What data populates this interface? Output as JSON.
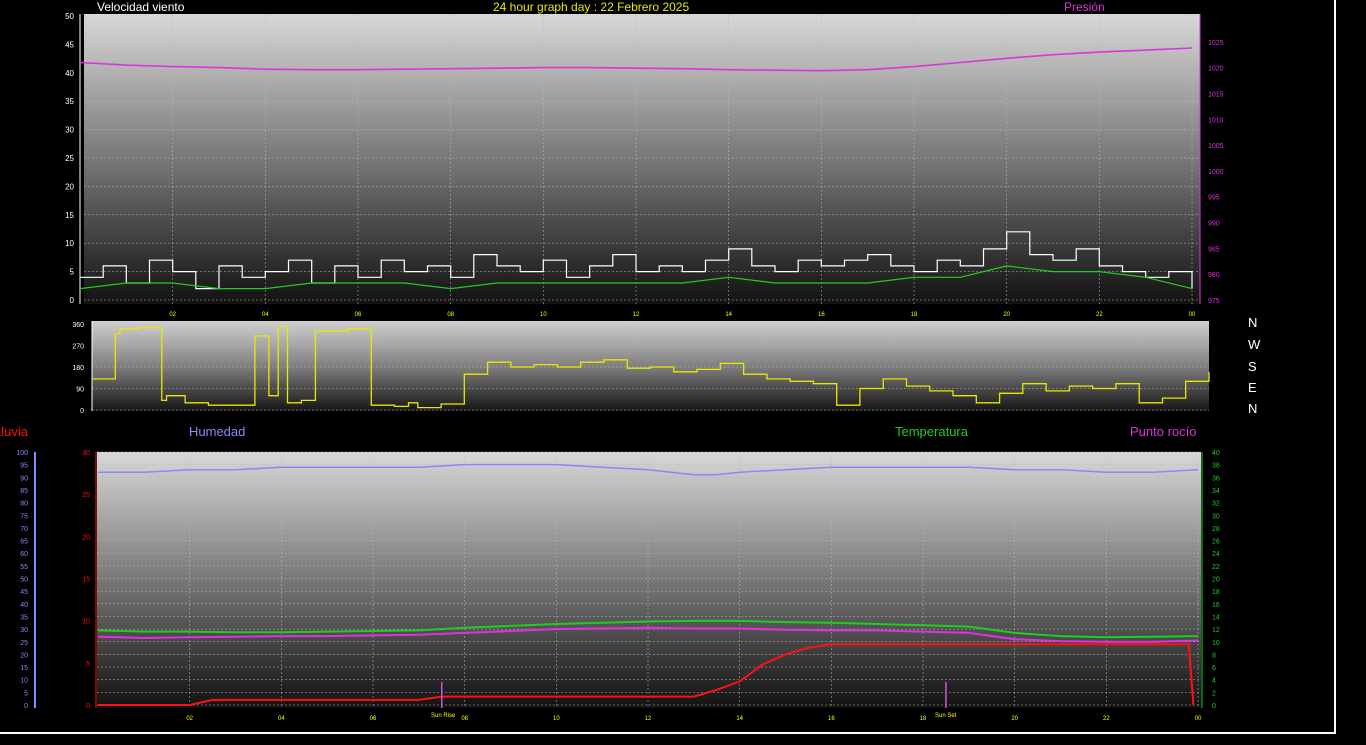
{
  "header": {
    "wind_title": "Velocidad viento",
    "graph_title": "24 hour graph day : 22 Febrero 2025",
    "pressure_title": "Presión"
  },
  "compass": [
    "N",
    "W",
    "S",
    "E",
    "N"
  ],
  "lower_legend": {
    "rain": "Lluvia",
    "humidity": "Humedad",
    "temperature": "Temperatura",
    "dewpoint": "Punto rocío"
  },
  "markers": {
    "sunrise": "Sun Rise",
    "sunset": "Sun Set"
  },
  "colors": {
    "wind": "#ffffff",
    "gust_avg": "#22cc22",
    "pressure": "#dd33dd",
    "direction": "#e8e800",
    "humidity": "#8888ff",
    "temperature": "#22cc22",
    "dewpoint": "#dd33dd",
    "rain": "#ff1111",
    "marker": "#cc55cc"
  },
  "chart_data": [
    {
      "type": "line",
      "name": "wind",
      "title": "Velocidad viento",
      "x_ticks": [
        "02",
        "04",
        "06",
        "08",
        "10",
        "12",
        "14",
        "16",
        "18",
        "20",
        "22",
        "00"
      ],
      "y_left_ticks": [
        0,
        5,
        10,
        15,
        20,
        25,
        30,
        35,
        40,
        45,
        50
      ],
      "y_right_ticks": [
        975,
        980,
        985,
        990,
        995,
        1000,
        1005,
        1010,
        1015,
        1020,
        1025
      ],
      "ylim_left": [
        0,
        50
      ],
      "ylim_right": [
        975,
        1030
      ],
      "series": [
        {
          "name": "Velocidad viento",
          "x": [
            0,
            0.5,
            1,
            1.5,
            2,
            2.5,
            3,
            3.5,
            4,
            4.5,
            5,
            5.5,
            6,
            6.5,
            7,
            7.5,
            8,
            8.5,
            9,
            9.5,
            10,
            10.5,
            11,
            11.5,
            12,
            12.5,
            13,
            13.5,
            14,
            14.5,
            15,
            15.5,
            16,
            16.5,
            17,
            17.5,
            18,
            18.5,
            19,
            19.5,
            20,
            20.5,
            21,
            21.5,
            22,
            22.5,
            23,
            23.5,
            24
          ],
          "values": [
            4,
            6,
            3,
            7,
            5,
            2,
            6,
            4,
            5,
            7,
            3,
            6,
            4,
            7,
            5,
            6,
            4,
            8,
            6,
            5,
            7,
            4,
            6,
            8,
            5,
            6,
            5,
            7,
            9,
            6,
            5,
            7,
            6,
            7,
            8,
            6,
            5,
            7,
            6,
            9,
            12,
            8,
            7,
            9,
            6,
            5,
            4,
            5,
            2
          ]
        },
        {
          "name": "Racha media",
          "x": [
            0,
            1,
            2,
            3,
            4,
            5,
            6,
            7,
            8,
            9,
            10,
            11,
            12,
            13,
            14,
            15,
            16,
            17,
            18,
            19,
            20,
            21,
            22,
            23,
            24
          ],
          "values": [
            2,
            3,
            3,
            2,
            2,
            3,
            3,
            3,
            2,
            3,
            3,
            3,
            3,
            3,
            4,
            3,
            3,
            3,
            4,
            4,
            6,
            5,
            5,
            4,
            2
          ]
        },
        {
          "name": "Presión",
          "axis": "right",
          "x": [
            0,
            1,
            2,
            3,
            4,
            5,
            6,
            7,
            8,
            9,
            10,
            11,
            12,
            13,
            14,
            15,
            16,
            17,
            18,
            19,
            20,
            21,
            22,
            23,
            24
          ],
          "values": [
            1021,
            1020.5,
            1020.2,
            1020,
            1019.7,
            1019.6,
            1019.6,
            1019.7,
            1019.8,
            1019.9,
            1020,
            1020,
            1019.9,
            1019.8,
            1019.6,
            1019.5,
            1019.4,
            1019.6,
            1020.2,
            1021,
            1021.8,
            1022.5,
            1023,
            1023.4,
            1023.8
          ]
        }
      ]
    },
    {
      "type": "line",
      "name": "direction",
      "y_ticks": [
        0,
        90,
        180,
        270,
        360
      ],
      "ylim": [
        0,
        360
      ],
      "series": [
        {
          "name": "Dirección viento",
          "x": [
            0,
            0.5,
            0.6,
            1,
            1.5,
            1.6,
            2,
            2.5,
            3,
            3.5,
            3.8,
            4,
            4.2,
            4.5,
            4.8,
            5,
            5.5,
            6,
            6.5,
            6.8,
            7,
            7.5,
            8,
            8.5,
            9,
            9.5,
            10,
            10.5,
            11,
            11.5,
            12,
            12.5,
            13,
            13.5,
            14,
            14.5,
            15,
            15.5,
            16,
            16.5,
            17,
            17.5,
            18,
            18.5,
            19,
            19.5,
            20,
            20.5,
            21,
            21.5,
            22,
            22.5,
            23,
            23.5,
            24
          ],
          "values": [
            130,
            320,
            340,
            345,
            40,
            60,
            30,
            20,
            20,
            310,
            60,
            350,
            30,
            40,
            330,
            330,
            340,
            20,
            15,
            30,
            10,
            25,
            150,
            200,
            180,
            190,
            180,
            200,
            210,
            175,
            180,
            160,
            170,
            195,
            150,
            130,
            120,
            110,
            20,
            90,
            130,
            100,
            80,
            60,
            30,
            70,
            110,
            80,
            100,
            90,
            110,
            30,
            50,
            120,
            160
          ]
        }
      ]
    },
    {
      "type": "line",
      "name": "rain-temp-humidity",
      "x_ticks": [
        "02",
        "04",
        "06",
        "08",
        "10",
        "12",
        "14",
        "16",
        "18",
        "20",
        "22",
        "00"
      ],
      "y_humidity_ticks": [
        0,
        5,
        10,
        15,
        20,
        25,
        30,
        35,
        40,
        45,
        50,
        55,
        60,
        65,
        70,
        75,
        80,
        85,
        90,
        95,
        100
      ],
      "y_rain_ticks": [
        0,
        5,
        10,
        15,
        20,
        25,
        30
      ],
      "y_temp_ticks": [
        0,
        2,
        4,
        6,
        8,
        10,
        12,
        14,
        16,
        18,
        20,
        22,
        24,
        26,
        28,
        30,
        32,
        34,
        36,
        38,
        40
      ],
      "ylim_rain": [
        0,
        30
      ],
      "ylim_temp": [
        0,
        40
      ],
      "series": [
        {
          "name": "Humedad",
          "axis": "humidity",
          "x": [
            0,
            1,
            2,
            3,
            4,
            5,
            6,
            7,
            8,
            9,
            10,
            11,
            12,
            13,
            13.5,
            14,
            15,
            16,
            17,
            18,
            19,
            20,
            21,
            22,
            23,
            24
          ],
          "values": [
            92,
            92,
            93,
            93,
            94,
            94,
            94,
            94,
            95,
            95,
            95,
            94,
            93,
            91,
            91,
            92,
            93,
            94,
            94,
            94,
            94,
            93,
            93,
            92,
            92,
            93
          ]
        },
        {
          "name": "Temperatura",
          "axis": "temp",
          "x": [
            0,
            1,
            2,
            3,
            4,
            5,
            6,
            7,
            8,
            9,
            10,
            11,
            12,
            13,
            14,
            15,
            16,
            17,
            18,
            19,
            20,
            21,
            22,
            23,
            24
          ],
          "values": [
            11.8,
            11.6,
            11.6,
            11.5,
            11.5,
            11.6,
            11.7,
            11.8,
            12.2,
            12.5,
            12.8,
            13.0,
            13.2,
            13.3,
            13.3,
            13.1,
            13.0,
            12.8,
            12.6,
            12.4,
            11.4,
            10.9,
            10.7,
            10.8,
            10.9
          ]
        },
        {
          "name": "Punto rocío",
          "axis": "temp",
          "x": [
            0,
            1,
            2,
            3,
            4,
            5,
            6,
            7,
            8,
            9,
            10,
            11,
            12,
            13,
            14,
            15,
            16,
            17,
            18,
            19,
            20,
            21,
            22,
            23,
            24
          ],
          "values": [
            10.8,
            10.6,
            10.7,
            10.8,
            10.9,
            10.9,
            11.0,
            11.1,
            11.4,
            11.7,
            12.0,
            12.1,
            12.2,
            12.1,
            12.1,
            11.9,
            11.8,
            11.8,
            11.6,
            11.4,
            10.4,
            10.1,
            10.0,
            10.0,
            10.2
          ]
        },
        {
          "name": "Lluvia",
          "axis": "rain",
          "x": [
            0,
            1,
            2,
            2.5,
            3,
            4,
            5,
            6,
            7,
            7.5,
            8,
            9,
            10,
            11,
            12,
            13,
            13.5,
            14,
            14.5,
            15,
            15.5,
            16,
            17,
            18,
            19,
            20,
            21,
            22,
            23,
            23.8,
            23.9
          ],
          "values": [
            0,
            0,
            0,
            0.6,
            0.6,
            0.6,
            0.6,
            0.6,
            0.6,
            1.0,
            1.0,
            1.0,
            1.0,
            1.0,
            1.0,
            1.0,
            1.8,
            2.8,
            4.8,
            6.0,
            6.8,
            7.2,
            7.2,
            7.2,
            7.2,
            7.2,
            7.2,
            7.2,
            7.2,
            7.2,
            0
          ]
        }
      ]
    }
  ]
}
